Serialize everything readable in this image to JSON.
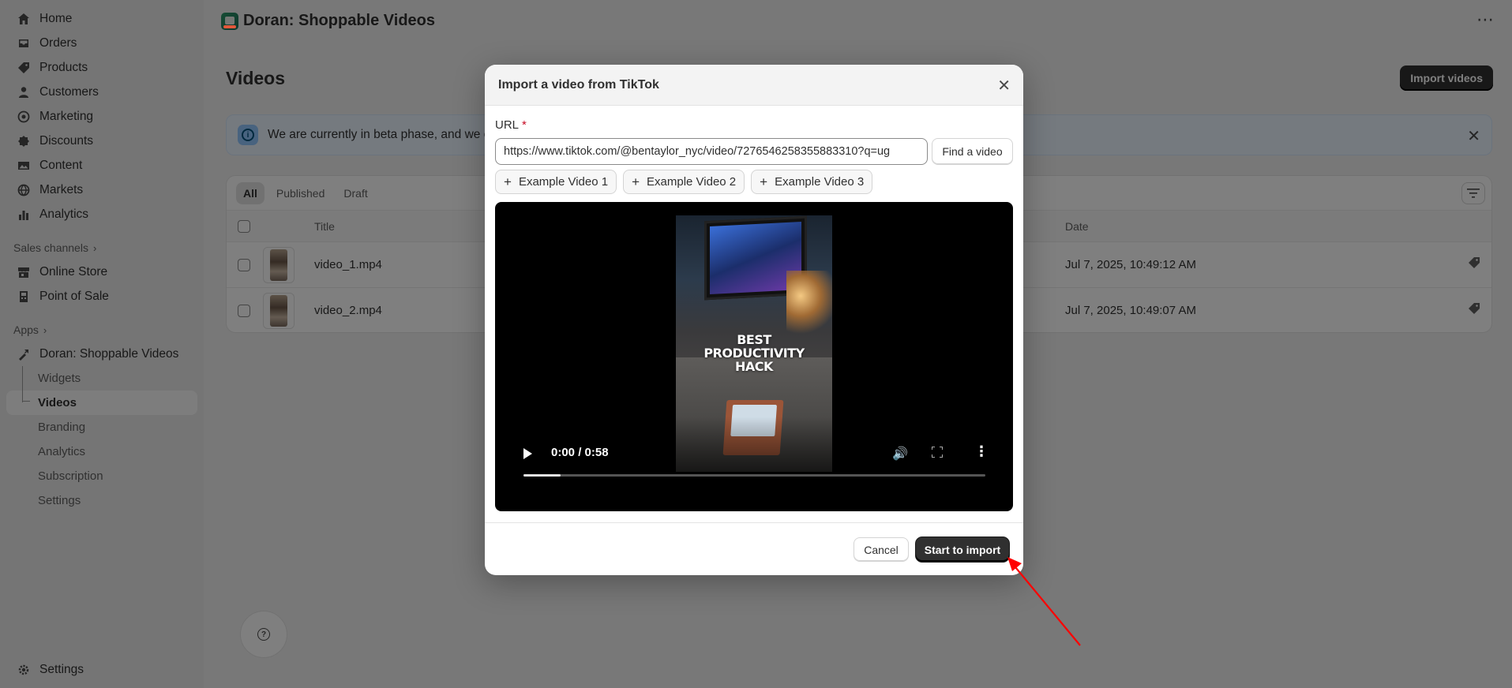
{
  "sidebar": {
    "main_items": [
      {
        "label": "Home",
        "icon": "home-icon"
      },
      {
        "label": "Orders",
        "icon": "inbox-icon"
      },
      {
        "label": "Products",
        "icon": "tag-icon"
      },
      {
        "label": "Customers",
        "icon": "person-icon"
      },
      {
        "label": "Marketing",
        "icon": "target-icon"
      },
      {
        "label": "Discounts",
        "icon": "discount-icon"
      },
      {
        "label": "Content",
        "icon": "image-icon"
      },
      {
        "label": "Markets",
        "icon": "globe-icon"
      },
      {
        "label": "Analytics",
        "icon": "bar-chart-icon"
      }
    ],
    "sales_channels_label": "Sales channels",
    "sales_channels": [
      {
        "label": "Online Store",
        "icon": "store-icon"
      },
      {
        "label": "Point of Sale",
        "icon": "pos-icon"
      }
    ],
    "apps_label": "Apps",
    "app_name": "Doran: Shoppable Videos",
    "app_items": [
      "Widgets",
      "Videos",
      "Branding",
      "Analytics",
      "Subscription",
      "Settings"
    ],
    "active_app_item": "Videos",
    "settings_label": "Settings"
  },
  "header": {
    "app_title": "Doran: Shoppable Videos",
    "more_glyph": "⋯"
  },
  "page": {
    "title": "Videos",
    "import_button": "Import videos",
    "banner_text": "We are currently in beta phase, and we c",
    "tabs": [
      "All",
      "Published",
      "Draft"
    ],
    "active_tab": "All",
    "columns": {
      "title": "Title",
      "date": "Date"
    },
    "rows": [
      {
        "title": "video_1.mp4",
        "date": "Jul 7, 2025, 10:49:12 AM"
      },
      {
        "title": "video_2.mp4",
        "date": "Jul 7, 2025, 10:49:07 AM"
      }
    ]
  },
  "modal": {
    "title": "Import a video from TikTok",
    "url_label": "URL",
    "required_mark": "*",
    "url_value": "https://www.tiktok.com/@bentaylor_nyc/video/7276546258355883310?q=ug",
    "find_button": "Find a video",
    "examples": [
      "Example Video 1",
      "Example Video 2",
      "Example Video 3"
    ],
    "video_overlay_text": [
      "BEST",
      "PRODUCTIVITY",
      "HACK"
    ],
    "player_time": "0:00 / 0:58",
    "progress": 0.08,
    "cancel_button": "Cancel",
    "start_button": "Start to import"
  },
  "colors": {
    "primary_button": "#303030",
    "banner_bg": "#eaf4ff",
    "annotation_arrow": "#ff0000"
  }
}
